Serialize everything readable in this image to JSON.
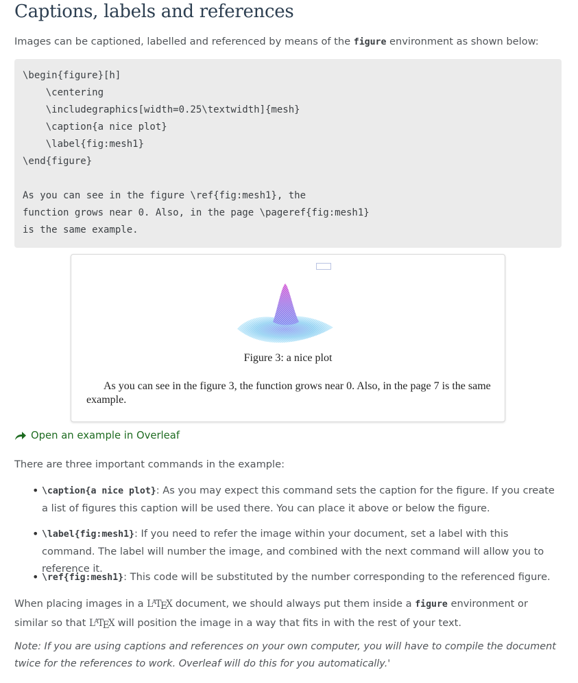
{
  "heading": "Captions, labels and references",
  "intro": {
    "before": "Images can be captioned, labelled and referenced by means of the ",
    "code": "figure",
    "after": " environment as shown below:"
  },
  "code_block": {
    "lines": [
      "\\begin{figure}[h]",
      "    \\centering",
      "    \\includegraphics[width=0.25\\textwidth]{mesh}",
      "    \\caption{a nice plot}",
      "    \\label{fig:mesh1}",
      "\\end{figure}",
      "",
      "As you can see in the figure \\ref{fig:mesh1}, the",
      "function grows near 0. Also, in the page \\pageref{fig:mesh1}",
      "is the same example."
    ]
  },
  "rendered_output": {
    "caption": "Figure 3: a nice plot",
    "paragraph": "As you can see in the figure 3, the function grows near 0. Also, in the page 7 is the same example.",
    "colors": {
      "mesh_top": "#d65ad6",
      "mesh_mid": "#7f8cf0",
      "mesh_base": "#7ec8f0"
    }
  },
  "open_link": {
    "label": "Open an example in Overleaf",
    "icon": "share-arrow-icon",
    "color": "#1d6b20"
  },
  "commands_intro": "There are three important commands in the example:",
  "commands": [
    {
      "code": "\\caption{a nice plot}",
      "text": ": As you may expect this command sets the caption for the figure. If you create a list of figures this caption will be used there. You can place it above or below the figure."
    },
    {
      "code": "\\label{fig:mesh1}",
      "text": ": If you need to refer the image within your document, set a label with this command. The label will number the image, and combined with the next command will allow you to reference it."
    },
    {
      "code": "\\ref{fig:mesh1}",
      "text": ": This code will be substituted by the number corresponding to the referenced figure."
    }
  ],
  "placement": {
    "part1": "When placing images in a ",
    "latex": "LaTeX",
    "part2": " document, we should always put them inside a ",
    "code": "figure",
    "part3": " environment or similar so that ",
    "part4": " will position the image in a way that fits in with the rest of your text."
  },
  "note": "Note: If you are using captions and references on your own computer, you will have to compile the document twice for the references to work. Overleaf will do this for you automatically.'"
}
